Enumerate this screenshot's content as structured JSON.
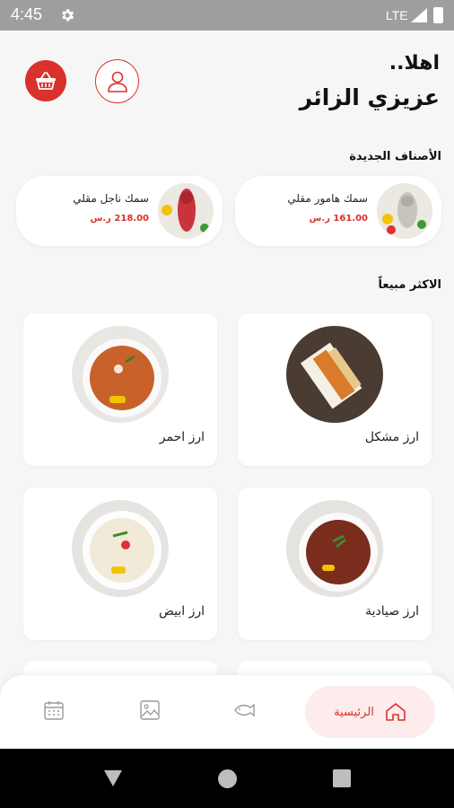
{
  "status_bar": {
    "time": "4:45",
    "network": "LTE"
  },
  "header": {
    "greeting_line1": "اهلا..",
    "greeting_line2": "عزيزي الزائر"
  },
  "sections": {
    "new_items_title": "الأصناف الجديدة",
    "best_sellers_title": "الاكثر مبيعاً"
  },
  "new_items": [
    {
      "name": "سمك هامور مقلي",
      "price": "161.00 ر.س"
    },
    {
      "name": "سمك ناجل مقلي",
      "price": "218.00 ر.س"
    }
  ],
  "best_sellers": [
    {
      "name": "ارز مشكل"
    },
    {
      "name": "ارز احمر"
    },
    {
      "name": "ارز صيادية"
    },
    {
      "name": "ارز ابيض"
    }
  ],
  "bottom_nav": {
    "home_label": "الرئيسية",
    "active": "home"
  },
  "colors": {
    "accent": "#d9312b",
    "home_pill": "#fcecec"
  }
}
